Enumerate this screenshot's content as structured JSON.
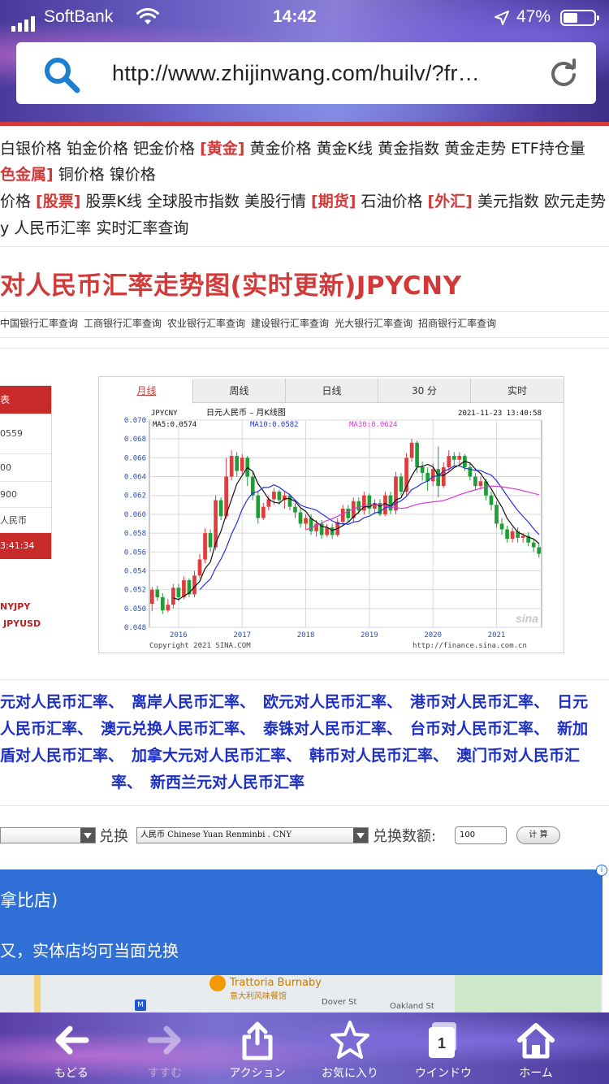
{
  "status_bar": {
    "carrier": "SoftBank",
    "time": "14:42",
    "battery": "47%",
    "battery_level": 0.47
  },
  "browser": {
    "url": "http://www.zhijinwang.com/huilv/?fr…"
  },
  "nav": {
    "line1": [
      {
        "text": "白银价格 铂金价格 钯金价格 ",
        "tag": false
      },
      {
        "text": "[黄金]",
        "tag": true
      },
      {
        "text": " 黄金价格 黄金K线 黄金指数 黄金走势 ETF持仓量",
        "tag": false
      }
    ],
    "line2": [
      {
        "text": "色金属]",
        "tag": true
      },
      {
        "text": " 铜价格 镍价格",
        "tag": false
      }
    ],
    "line3": [
      {
        "text": "价格 ",
        "tag": false
      },
      {
        "text": "[股票]",
        "tag": true
      },
      {
        "text": " 股票K线 全球股市指数 美股行情 ",
        "tag": false
      },
      {
        "text": "[期货]",
        "tag": true
      },
      {
        "text": " 石油价格 ",
        "tag": false
      },
      {
        "text": "[外汇]",
        "tag": true
      },
      {
        "text": " 美元指数 欧元走势",
        "tag": false
      }
    ],
    "line4": [
      {
        "text": "y 人民币汇率 实时汇率查询",
        "tag": false
      }
    ]
  },
  "page_title": "对人民币汇率走势图(实时更新)JPYCNY",
  "bank_links": [
    "中国银行汇率查询",
    "工商银行汇率查询",
    "农业银行汇率查询",
    "建设银行汇率查询",
    "光大银行汇率查询",
    "招商银行汇率查询"
  ],
  "side_panel": {
    "head": "表",
    "cells": [
      "0559",
      "00",
      "900",
      "人民币"
    ],
    "foot": "3:41:34",
    "link1": "NYJPY",
    "link2": "JPYUSD"
  },
  "chart_tabs": [
    "月线",
    "周线",
    "日线",
    "30 分",
    "实时"
  ],
  "chart_data": {
    "type": "candlestick",
    "symbol": "JPYCNY",
    "title": "日元人民币 – 月K线图",
    "timestamp": "2021-11-23 13:40:58",
    "ma_labels": {
      "ma5": "MA5:0.0574",
      "ma10": "MA10:0.0582",
      "ma30": "MA30:0.0624"
    },
    "colors": {
      "up": "#e03c3c",
      "down": "#1f9e35",
      "ma5": "#111111",
      "ma10": "#2233dd",
      "ma30": "#d43bd4"
    },
    "ylim": [
      0.048,
      0.07
    ],
    "yticks": [
      "0.070",
      "0.068",
      "0.066",
      "0.064",
      "0.062",
      "0.060",
      "0.058",
      "0.056",
      "0.054",
      "0.052",
      "0.050",
      "0.048"
    ],
    "xticks": [
      {
        "label": "2016",
        "index": 5
      },
      {
        "label": "2017",
        "index": 17
      },
      {
        "label": "2018",
        "index": 29
      },
      {
        "label": "2019",
        "index": 41
      },
      {
        "label": "2020",
        "index": 53
      },
      {
        "label": "2021",
        "index": 65
      }
    ],
    "candles": [
      [
        0.0505,
        0.052,
        0.0497,
        0.0523
      ],
      [
        0.052,
        0.0512,
        0.0508,
        0.0524
      ],
      [
        0.0512,
        0.0498,
        0.0494,
        0.0516
      ],
      [
        0.0498,
        0.0504,
        0.0496,
        0.051
      ],
      [
        0.0504,
        0.0522,
        0.05,
        0.0526
      ],
      [
        0.0522,
        0.0512,
        0.0508,
        0.0526
      ],
      [
        0.0512,
        0.053,
        0.051,
        0.0534
      ],
      [
        0.053,
        0.0515,
        0.0512,
        0.0532
      ],
      [
        0.0515,
        0.0535,
        0.0512,
        0.054
      ],
      [
        0.0535,
        0.0552,
        0.0532,
        0.0558
      ],
      [
        0.0552,
        0.058,
        0.0548,
        0.0585
      ],
      [
        0.058,
        0.0565,
        0.056,
        0.0584
      ],
      [
        0.0565,
        0.0615,
        0.0562,
        0.062
      ],
      [
        0.0615,
        0.0598,
        0.0594,
        0.0618
      ],
      [
        0.0598,
        0.064,
        0.0595,
        0.066
      ],
      [
        0.064,
        0.0662,
        0.0636,
        0.0668
      ],
      [
        0.0662,
        0.0646,
        0.064,
        0.0666
      ],
      [
        0.0646,
        0.066,
        0.0642,
        0.0664
      ],
      [
        0.066,
        0.064,
        0.063,
        0.0662
      ],
      [
        0.064,
        0.062,
        0.0615,
        0.0645
      ],
      [
        0.062,
        0.0596,
        0.059,
        0.0624
      ],
      [
        0.0596,
        0.0608,
        0.0594,
        0.0612
      ],
      [
        0.0608,
        0.0616,
        0.0604,
        0.062
      ],
      [
        0.0616,
        0.0624,
        0.061,
        0.0628
      ],
      [
        0.0624,
        0.0615,
        0.061,
        0.0626
      ],
      [
        0.0615,
        0.062,
        0.0606,
        0.0624
      ],
      [
        0.062,
        0.0608,
        0.0604,
        0.0622
      ],
      [
        0.0608,
        0.0602,
        0.0596,
        0.0612
      ],
      [
        0.0602,
        0.059,
        0.0586,
        0.0606
      ],
      [
        0.059,
        0.0596,
        0.0584,
        0.06
      ],
      [
        0.0596,
        0.0582,
        0.0578,
        0.06
      ],
      [
        0.0582,
        0.059,
        0.0576,
        0.0594
      ],
      [
        0.059,
        0.0578,
        0.0574,
        0.0594
      ],
      [
        0.0578,
        0.0586,
        0.0576,
        0.059
      ],
      [
        0.0586,
        0.0578,
        0.0574,
        0.059
      ],
      [
        0.0578,
        0.0592,
        0.0576,
        0.0596
      ],
      [
        0.0592,
        0.0606,
        0.0588,
        0.061
      ],
      [
        0.0606,
        0.0596,
        0.0592,
        0.061
      ],
      [
        0.0596,
        0.0614,
        0.0592,
        0.0618
      ],
      [
        0.0614,
        0.0604,
        0.06,
        0.0618
      ],
      [
        0.0604,
        0.062,
        0.06,
        0.0624
      ],
      [
        0.062,
        0.0606,
        0.06,
        0.0622
      ],
      [
        0.0606,
        0.0612,
        0.06,
        0.0616
      ],
      [
        0.0612,
        0.06,
        0.0598,
        0.0616
      ],
      [
        0.06,
        0.062,
        0.0598,
        0.0624
      ],
      [
        0.062,
        0.0604,
        0.06,
        0.0624
      ],
      [
        0.0604,
        0.064,
        0.06,
        0.0645
      ],
      [
        0.064,
        0.0624,
        0.062,
        0.0644
      ],
      [
        0.0624,
        0.066,
        0.062,
        0.0665
      ],
      [
        0.066,
        0.0676,
        0.0656,
        0.068
      ],
      [
        0.0676,
        0.065,
        0.0644,
        0.0678
      ],
      [
        0.065,
        0.0644,
        0.0636,
        0.0656
      ],
      [
        0.0644,
        0.0635,
        0.0625,
        0.065
      ],
      [
        0.0635,
        0.0648,
        0.063,
        0.0654
      ],
      [
        0.0648,
        0.063,
        0.0618,
        0.0672
      ],
      [
        0.063,
        0.065,
        0.0628,
        0.0655
      ],
      [
        0.065,
        0.0662,
        0.0646,
        0.0668
      ],
      [
        0.0662,
        0.0658,
        0.0652,
        0.0666
      ],
      [
        0.0658,
        0.0662,
        0.0652,
        0.0666
      ],
      [
        0.0662,
        0.065,
        0.0646,
        0.0664
      ],
      [
        0.065,
        0.064,
        0.0636,
        0.0654
      ],
      [
        0.064,
        0.063,
        0.0626,
        0.0644
      ],
      [
        0.063,
        0.0635,
        0.0626,
        0.064
      ],
      [
        0.0635,
        0.062,
        0.0615,
        0.0638
      ],
      [
        0.062,
        0.061,
        0.0604,
        0.0624
      ],
      [
        0.061,
        0.059,
        0.0586,
        0.0614
      ],
      [
        0.059,
        0.0584,
        0.0578,
        0.0596
      ],
      [
        0.0584,
        0.0574,
        0.057,
        0.0588
      ],
      [
        0.0574,
        0.0582,
        0.057,
        0.0586
      ],
      [
        0.0582,
        0.0575,
        0.057,
        0.0586
      ],
      [
        0.0575,
        0.0577,
        0.057,
        0.058
      ],
      [
        0.0577,
        0.057,
        0.0566,
        0.0581
      ],
      [
        0.057,
        0.0565,
        0.056,
        0.0574
      ],
      [
        0.0565,
        0.0558,
        0.0554,
        0.057
      ]
    ],
    "copyright": "Copyright 2021 SINA.COM",
    "source_url": "http://finance.sina.com.cn",
    "watermark": "sina"
  },
  "currency_links": [
    [
      "元对人民币汇率、",
      "离岸人民币汇率、",
      "欧元对人民币汇率、",
      "港币对人民币汇率、",
      "日元"
    ],
    [
      "人民币汇率、",
      "澳元兑换人民币汇率、",
      "泰铢对人民币汇率、",
      "台币对人民币汇率、",
      "新加"
    ],
    [
      "盾对人民币汇率、",
      "加拿大元对人民币汇率、",
      "韩币对人民币汇率、",
      "澳门币对人民币汇"
    ],
    [
      "率、",
      "新西兰元对人民币汇率"
    ]
  ],
  "converter": {
    "from_value": "",
    "label_exchange": "兑换",
    "to_value": "人民币 Chinese Yuan Renminbi . CNY",
    "label_amount": "兑换数额:",
    "amount": "100",
    "calc_label": "计 算"
  },
  "ad": {
    "title": "拿比店)",
    "desc": "又，实体店均可当面兑换",
    "info_icon": "i",
    "map": {
      "place_name": "Trattoria Burnaby",
      "place_name_zh": "意大利风味餐馆",
      "street1": "Dover St",
      "street2": "Oakland St",
      "metro": "M"
    }
  },
  "toolbar": [
    {
      "name": "back",
      "label": "もどる",
      "icon": "arrow-left-icon"
    },
    {
      "name": "forward",
      "label": "すすむ",
      "icon": "arrow-right-icon"
    },
    {
      "name": "action",
      "label": "アクション",
      "icon": "share-icon"
    },
    {
      "name": "favorites",
      "label": "お気に入り",
      "icon": "star-icon"
    },
    {
      "name": "window",
      "label": "ウインドウ",
      "icon": "tabs-icon",
      "count": "1"
    },
    {
      "name": "home",
      "label": "ホーム",
      "icon": "home-icon"
    }
  ]
}
